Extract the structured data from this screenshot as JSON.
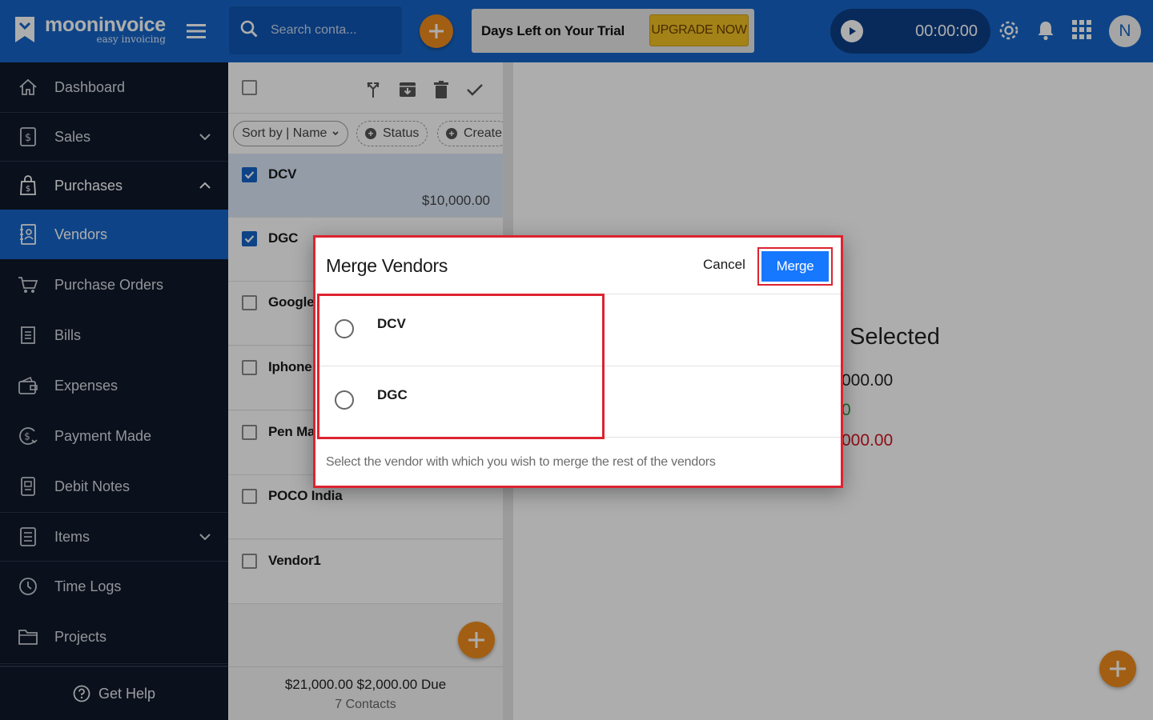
{
  "app": {
    "logo_title": "mooninvoice",
    "logo_subtitle": "easy invoicing"
  },
  "header": {
    "search_placeholder": "Search conta...",
    "trial_text": "Days Left on Your Trial",
    "upgrade_label": "UPGRADE NOW",
    "timer_value": "00:00:00",
    "avatar_initial": "N"
  },
  "colors": {
    "brand_blue": "#1665c7",
    "sidebar_bg": "#10192a",
    "accent_orange": "#ef8c1d",
    "upgrade_yellow": "#f0c024",
    "merge_blue": "#1677ff",
    "highlight_red": "#dd2330"
  },
  "sidebar": {
    "items": [
      {
        "label": "Dashboard",
        "icon": "home-icon"
      },
      {
        "label": "Sales",
        "icon": "dollar-doc-icon",
        "chevron": "down"
      },
      {
        "label": "Purchases",
        "icon": "shopping-bag-icon",
        "chevron": "up"
      },
      {
        "label": "Vendors",
        "icon": "address-book-icon",
        "active": true
      },
      {
        "label": "Purchase Orders",
        "icon": "cart-icon"
      },
      {
        "label": "Bills",
        "icon": "bill-icon"
      },
      {
        "label": "Expenses",
        "icon": "wallet-icon"
      },
      {
        "label": "Payment Made",
        "icon": "payment-icon"
      },
      {
        "label": "Debit Notes",
        "icon": "debit-note-icon"
      },
      {
        "label": "Items",
        "icon": "items-icon",
        "chevron": "down"
      },
      {
        "label": "Time Logs",
        "icon": "clock-icon"
      },
      {
        "label": "Projects",
        "icon": "folder-icon"
      }
    ],
    "get_help": "Get Help"
  },
  "list": {
    "sort_label": "Sort by | Name",
    "status_label": "Status",
    "create_label": "Create",
    "rows": [
      {
        "name": "DCV",
        "amount": "$10,000.00",
        "checked": true
      },
      {
        "name": "DGC",
        "amount": "",
        "checked": true
      },
      {
        "name": "Google",
        "amount": "",
        "checked": false
      },
      {
        "name": "Iphone",
        "amount": "",
        "checked": false
      },
      {
        "name": "Pen Mal",
        "amount": "",
        "checked": false
      },
      {
        "name": "POCO India",
        "amount": "",
        "checked": false
      },
      {
        "name": "Vendor1",
        "amount": "",
        "checked": false
      }
    ],
    "footer_totals": "$21,000.00  $2,000.00  Due",
    "footer_count": "7 Contacts"
  },
  "detail": {
    "title_fragment": "Selected",
    "values": [
      {
        "text": "000.00",
        "color": "#222222"
      },
      {
        "text": "0",
        "color": "#2e9a3c"
      },
      {
        "text": "000.00",
        "color": "#d0161f"
      }
    ]
  },
  "modal": {
    "title": "Merge Vendors",
    "cancel_label": "Cancel",
    "merge_label": "Merge",
    "options": [
      "DCV",
      "DGC"
    ],
    "hint": "Select the vendor with which you wish to merge the rest of the vendors"
  }
}
